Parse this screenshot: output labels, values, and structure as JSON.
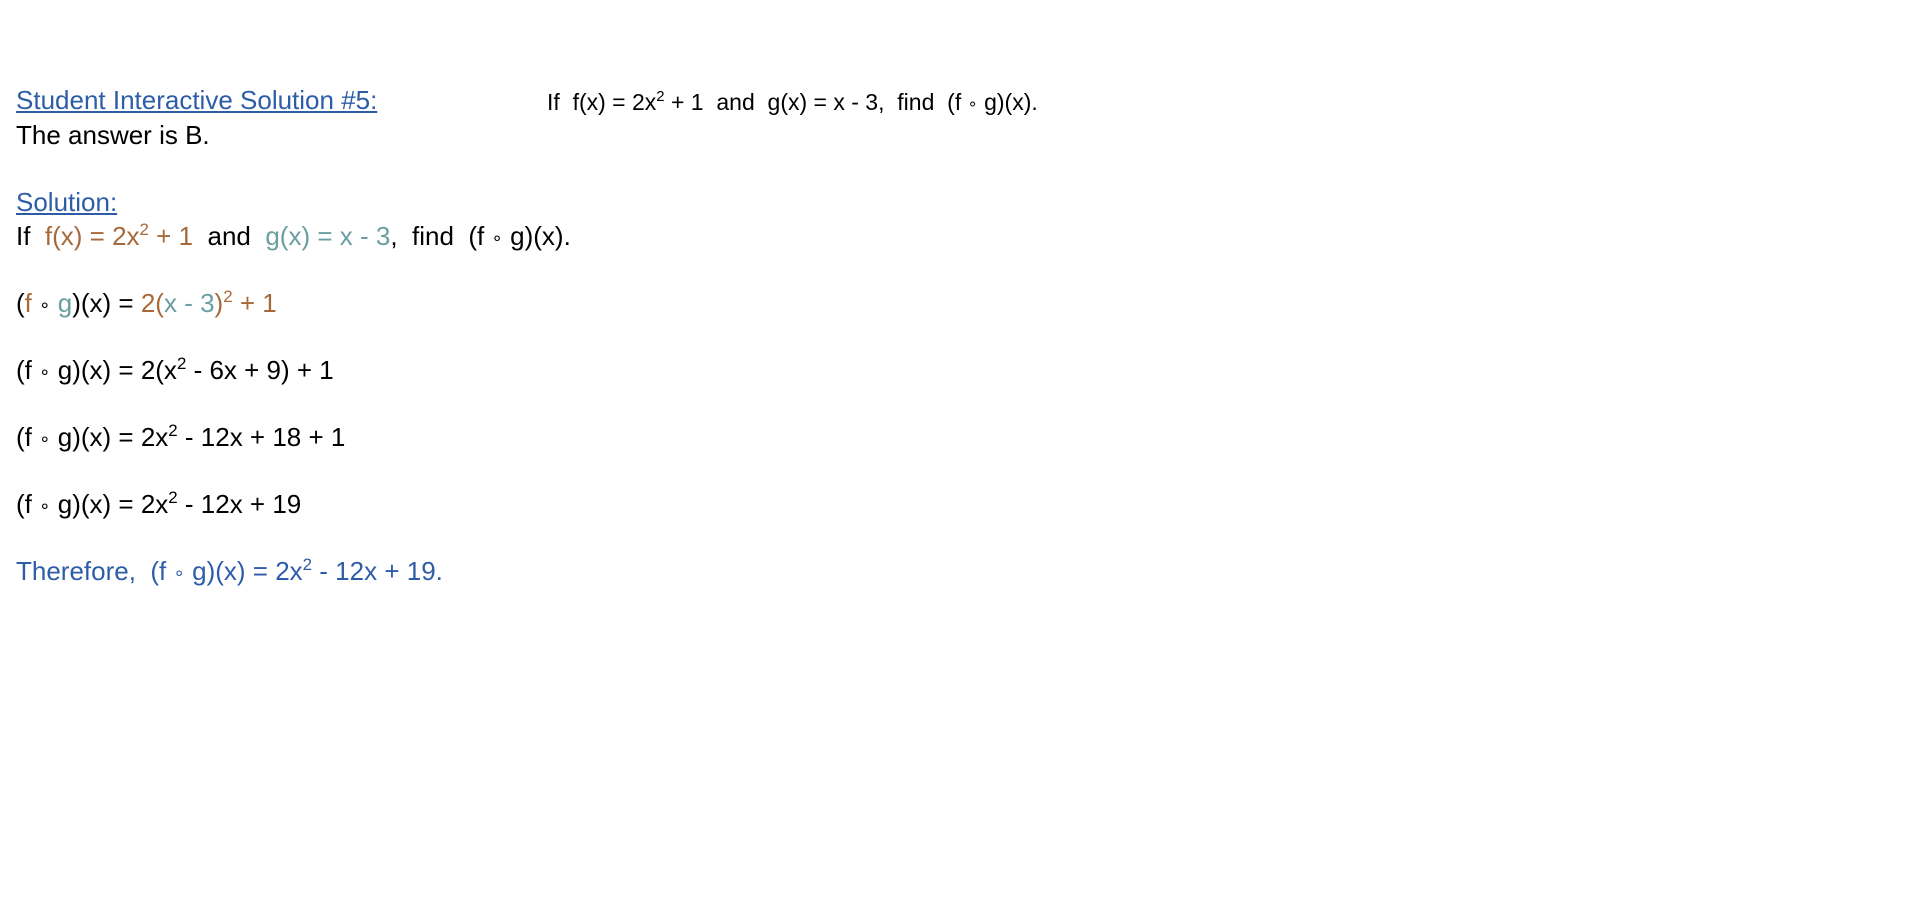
{
  "header": {
    "title": "Student Interactive Solution #5:",
    "problem": {
      "if": "If",
      "f": "f(x) = 2x",
      "f_exp": "2",
      "f_rest": " + 1",
      "and": "and",
      "g": "g(x) = x - 3,",
      "find": "find",
      "comp_open": "(f",
      "comp_op": "∘",
      "comp_close": "g)(x)."
    }
  },
  "answer": "The answer is B.",
  "solution": {
    "label": "Solution:",
    "statement": {
      "if": "If",
      "f": "f(x) = 2x",
      "f_exp": "2",
      "f_rest": " + 1",
      "and": "and",
      "g": "g(x) = x - 3",
      "comma": ",",
      "find": "find",
      "comp_open": "(f",
      "comp_op": "∘",
      "comp_close": "g)(x)."
    },
    "step1": {
      "open": "(",
      "f": "f",
      "op": "∘",
      "g": "g",
      "close": ")(x) = ",
      "rhs_a": "2(",
      "rhs_b": "x - 3",
      "rhs_c": ")",
      "rhs_exp": "2",
      "rhs_d": " + 1"
    },
    "step2": {
      "lhs_a": "(f",
      "op": "∘",
      "lhs_b": "g)(x) = 2(x",
      "exp": "2",
      "rest": " - 6x + 9) + 1"
    },
    "step3": {
      "lhs_a": "(f",
      "op": "∘",
      "lhs_b": "g)(x) = 2x",
      "exp": "2",
      "rest": " - 12x + 18 + 1"
    },
    "step4": {
      "lhs_a": "(f",
      "op": "∘",
      "lhs_b": "g)(x) = 2x",
      "exp": "2",
      "rest": " - 12x + 19"
    },
    "conclusion": {
      "prefix": "Therefore,  (f",
      "op": "∘",
      "mid": "g)(x) = 2x",
      "exp": "2",
      "rest": " - 12x + 19."
    }
  },
  "colors": {
    "link_blue": "#2e5da8",
    "f_brown": "#a8693a",
    "g_teal": "#6a9ea0"
  }
}
